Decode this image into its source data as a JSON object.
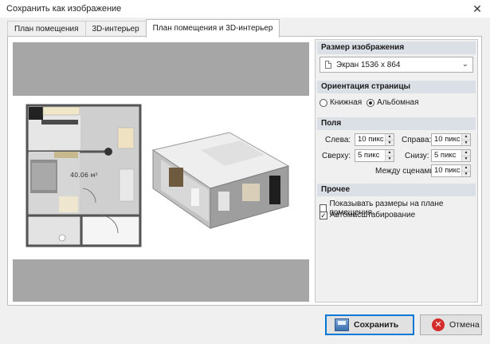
{
  "window": {
    "title": "Сохранить как изображение",
    "close_glyph": "✕"
  },
  "tabs": [
    {
      "label": "План помещения",
      "active": false
    },
    {
      "label": "3D-интерьер",
      "active": false
    },
    {
      "label": "План помещения и 3D-интерьер",
      "active": true
    }
  ],
  "preview": {
    "area_label": "40.06 м²"
  },
  "settings": {
    "size": {
      "header": "Размер изображения",
      "selected": "Экран 1536 x 864",
      "icon": "document-icon"
    },
    "orientation": {
      "header": "Ориентация страницы",
      "portrait": "Книжная",
      "landscape": "Альбомная",
      "selected": "landscape"
    },
    "margins": {
      "header": "Поля",
      "left_label": "Слева:",
      "left_value": "10 пикс",
      "right_label": "Справа:",
      "right_value": "10 пикс",
      "top_label": "Сверху:",
      "top_value": "5 пикс",
      "bottom_label": "Снизу:",
      "bottom_value": "5 пикс",
      "between_label": "Между сценами:",
      "between_value": "10 пикс"
    },
    "other": {
      "header": "Прочее",
      "show_dimensions_label": "Показывать размеры на плане помещения",
      "show_dimensions_checked": false,
      "autoscale_label": "Автомасштабирование",
      "autoscale_checked": true
    }
  },
  "buttons": {
    "save_label": "Сохранить",
    "cancel_label": "Отмена"
  },
  "colors": {
    "accent": "#0078d7",
    "section_header": "#dbe0e6",
    "preview_bg": "#a6a6a6",
    "cancel_red": "#d42b2b"
  }
}
